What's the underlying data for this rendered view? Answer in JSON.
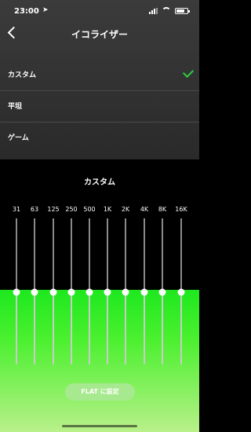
{
  "status": {
    "time": "23:00",
    "location_icon": "➤"
  },
  "nav": {
    "title": "イコライザー"
  },
  "presets": [
    {
      "label": "カスタム",
      "selected": true
    },
    {
      "label": "平坦",
      "selected": false
    },
    {
      "label": "ゲーム",
      "selected": false
    }
  ],
  "equalizer": {
    "title": "カスタム",
    "bands": [
      "31",
      "63",
      "125",
      "250",
      "500",
      "1K",
      "2K",
      "4K",
      "8K",
      "16K"
    ],
    "flat_button": "FLAT に設定"
  },
  "colors": {
    "accent_check": "#2ecc40",
    "fill_green": "#1ee81e"
  }
}
